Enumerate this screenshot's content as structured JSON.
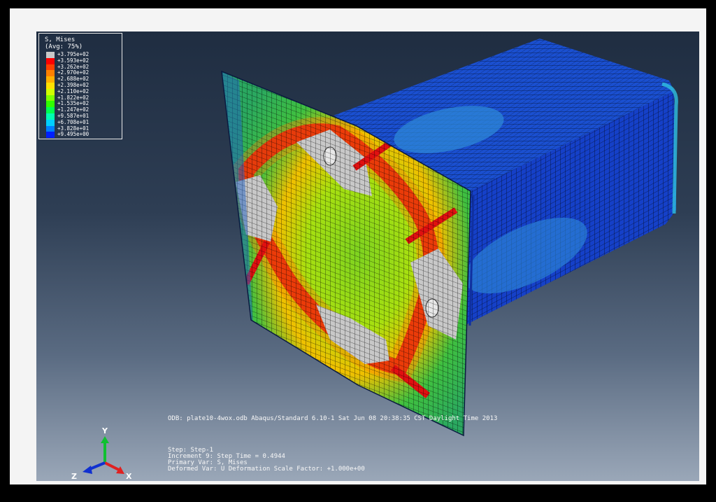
{
  "legend": {
    "title": "S, Mises",
    "averaging": "(Avg: 75%)",
    "entries": [
      {
        "value": "+3.795e+02",
        "color": "#c8c8c8"
      },
      {
        "value": "+3.593e+02",
        "color": "#ff0000"
      },
      {
        "value": "+3.262e+02",
        "color": "#ff4000"
      },
      {
        "value": "+2.970e+02",
        "color": "#ff8000"
      },
      {
        "value": "+2.688e+02",
        "color": "#ffb000"
      },
      {
        "value": "+2.398e+02",
        "color": "#ffe000"
      },
      {
        "value": "+2.110e+02",
        "color": "#d0ff00"
      },
      {
        "value": "+1.822e+02",
        "color": "#80ff00"
      },
      {
        "value": "+1.535e+02",
        "color": "#30ff00"
      },
      {
        "value": "+1.247e+02",
        "color": "#00ff50"
      },
      {
        "value": "+9.587e+01",
        "color": "#00ffb0"
      },
      {
        "value": "+6.708e+01",
        "color": "#00d0ff"
      },
      {
        "value": "+3.828e+01",
        "color": "#0080ff"
      },
      {
        "value": "+9.495e+00",
        "color": "#0020ff"
      }
    ]
  },
  "info": {
    "odb_line": "ODB: plate10-4wox.odb    Abaqus/Standard 6.10-1    Sat Jun 08 20:38:35 CST Daylight Time 2013",
    "step": "Step: Step-1",
    "increment": "Increment     9: Step Time =    0.4944",
    "primary_var": "Primary Var: S, Mises",
    "deformed_var": "Deformed Var: U   Deformation Scale Factor: +1.000e+00"
  },
  "triad": {
    "x_label": "X",
    "y_label": "Y",
    "z_label": "Z"
  },
  "colors": {
    "background_top": "#1f2d41",
    "background_bottom": "#9aa7b8",
    "tube_blue": "#1040d8",
    "high_stress": "#e01010",
    "mid_stress": "#40d020",
    "over_limit_gray": "#c8c8c8"
  }
}
